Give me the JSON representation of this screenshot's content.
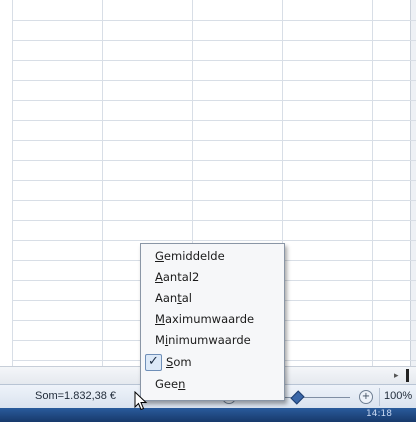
{
  "status_bar": {
    "sum_text": "Som=1.832,38 €",
    "zoom_minus": "−",
    "zoom_plus": "+",
    "zoom_value": "100%"
  },
  "taskbar": {
    "text": "14:18"
  },
  "context_menu": {
    "items": [
      {
        "pre": "",
        "key": "G",
        "post": "emiddelde",
        "checked": false
      },
      {
        "pre": "",
        "key": "A",
        "post": "antal2",
        "checked": false
      },
      {
        "pre": "Aan",
        "key": "t",
        "post": "al",
        "checked": false
      },
      {
        "pre": "",
        "key": "M",
        "post": "aximumwaarde",
        "checked": false
      },
      {
        "pre": "M",
        "key": "i",
        "post": "nimumwaarde",
        "checked": false
      },
      {
        "pre": "",
        "key": "S",
        "post": "om",
        "checked": true
      },
      {
        "pre": "Gee",
        "key": "n",
        "post": "",
        "checked": false
      }
    ],
    "check_icon": "✓"
  }
}
